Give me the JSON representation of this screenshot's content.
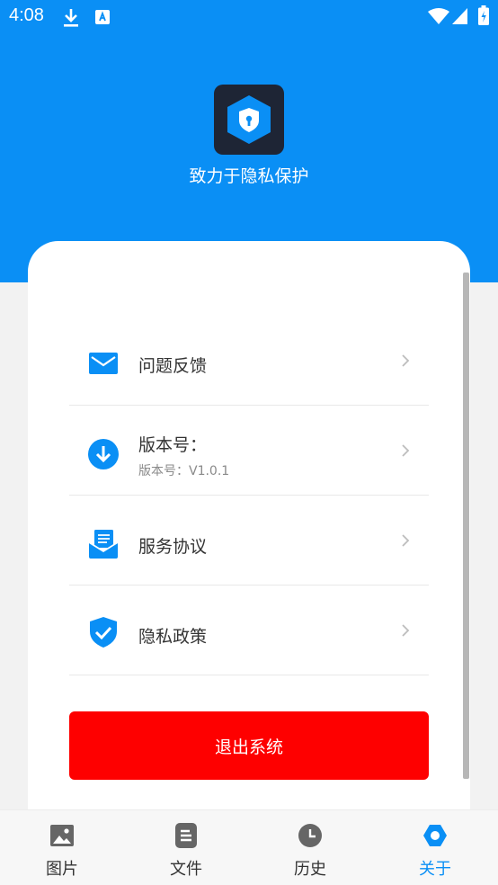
{
  "status_bar": {
    "time": "4:08",
    "icons": [
      "download-icon",
      "accessibility-icon",
      "wifi-icon",
      "signal-icon",
      "battery-icon"
    ]
  },
  "header": {
    "logo_icon": "shield-lock-icon",
    "slogan": "致力于隐私保护"
  },
  "menu": [
    {
      "icon": "mail-icon",
      "label": "问题反馈"
    },
    {
      "icon": "download-circle-icon",
      "label": "版本号：",
      "sub": "版本号：V1.0.1"
    },
    {
      "icon": "agreement-icon",
      "label": "服务协议"
    },
    {
      "icon": "shield-check-icon",
      "label": "隐私政策"
    }
  ],
  "logout_label": "退出系统",
  "bottom_nav": {
    "active_index": 3,
    "tabs": [
      {
        "icon": "image-icon",
        "label": "图片"
      },
      {
        "icon": "file-icon",
        "label": "文件"
      },
      {
        "icon": "clock-icon",
        "label": "历史"
      },
      {
        "icon": "settings-icon",
        "label": "关于"
      }
    ]
  },
  "colors": {
    "primary": "#0a8ff5",
    "danger": "#fe0000",
    "logo_bg": "#1e2535"
  }
}
